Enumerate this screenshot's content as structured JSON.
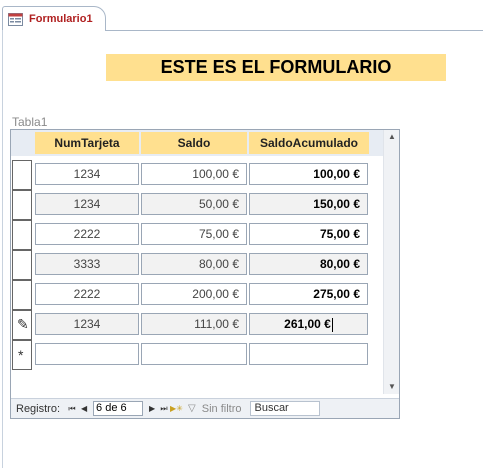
{
  "tab": {
    "label": "Formulario1"
  },
  "form": {
    "title": "ESTE ES EL FORMULARIO",
    "subform_label": "Tabla1"
  },
  "columns": [
    "NumTarjeta",
    "Saldo",
    "SaldoAcumulado"
  ],
  "rows": [
    {
      "num_tarjeta": "1234",
      "saldo": "100,00 €",
      "saldo_acumulado": "100,00 €"
    },
    {
      "num_tarjeta": "1234",
      "saldo": "50,00 €",
      "saldo_acumulado": "150,00 €"
    },
    {
      "num_tarjeta": "2222",
      "saldo": "75,00 €",
      "saldo_acumulado": "75,00 €"
    },
    {
      "num_tarjeta": "3333",
      "saldo": "80,00 €",
      "saldo_acumulado": "80,00 €"
    },
    {
      "num_tarjeta": "2222",
      "saldo": "200,00 €",
      "saldo_acumulado": "275,00 €"
    },
    {
      "num_tarjeta": "1234",
      "saldo": "111,00 €",
      "saldo_acumulado": "261,00 €"
    }
  ],
  "row_indicators": {
    "editing": "pencil-icon",
    "new": "new-record-asterisk-icon"
  },
  "navigation": {
    "label": "Registro:",
    "position": "6 de 6",
    "filter_label": "Sin filtro",
    "search_placeholder": "Buscar"
  },
  "colors": {
    "accent": "#ffe08f",
    "tab_text": "#b02020",
    "header_bg": "#e7ecf3",
    "alt_row": "#f2f2f2"
  }
}
